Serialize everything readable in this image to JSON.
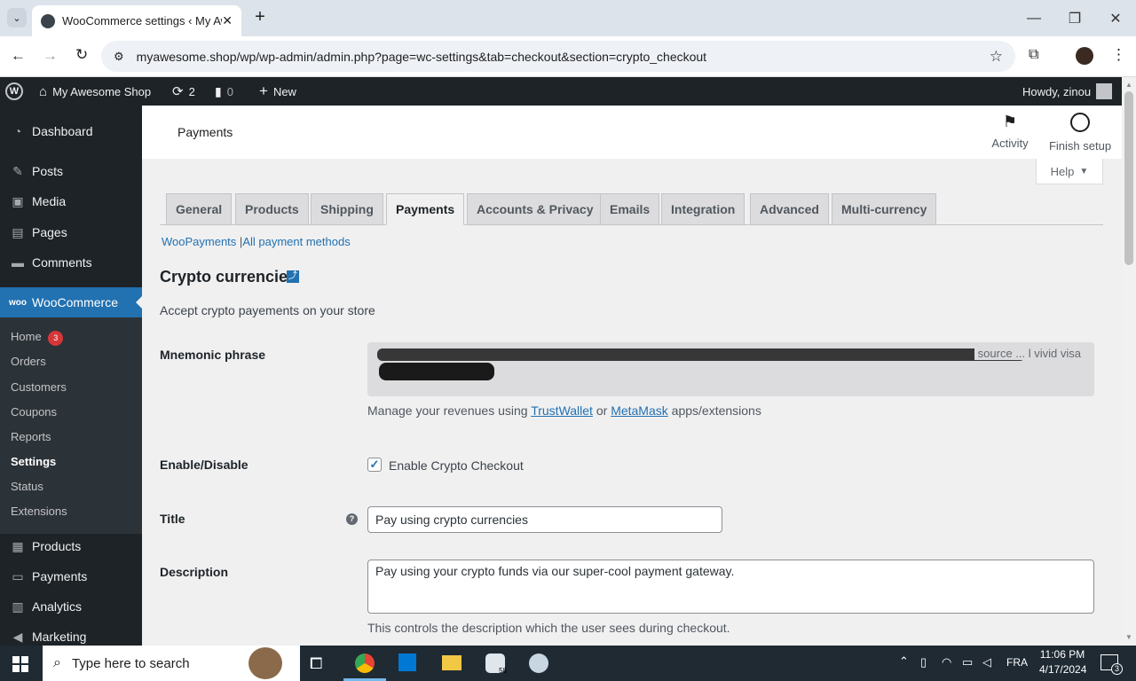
{
  "browser": {
    "tab_title": "WooCommerce settings ‹ My Awesome Shop",
    "url": "myawesome.shop/wp/wp-admin/admin.php?page=wc-settings&tab=checkout&section=crypto_checkout"
  },
  "adminbar": {
    "site_name": "My Awesome Shop",
    "updates_count": "2",
    "comments_count": "0",
    "new_label": "New",
    "howdy": "Howdy, zinou"
  },
  "sidebar": {
    "items_top": [
      {
        "label": "Dashboard",
        "icon": "dashboard-icon"
      },
      {
        "label": "Posts",
        "icon": "pin-icon"
      },
      {
        "label": "Media",
        "icon": "media-icon"
      },
      {
        "label": "Pages",
        "icon": "pages-icon"
      },
      {
        "label": "Comments",
        "icon": "comment-icon"
      }
    ],
    "woocommerce": "WooCommerce",
    "submenu": [
      {
        "label": "Home",
        "badge": "3"
      },
      {
        "label": "Orders"
      },
      {
        "label": "Customers"
      },
      {
        "label": "Coupons"
      },
      {
        "label": "Reports"
      },
      {
        "label": "Settings"
      },
      {
        "label": "Status"
      },
      {
        "label": "Extensions"
      }
    ],
    "items_bottom": [
      {
        "label": "Products"
      },
      {
        "label": "Payments"
      },
      {
        "label": "Analytics"
      },
      {
        "label": "Marketing"
      }
    ]
  },
  "header": {
    "page_title": "Payments",
    "activity": "Activity",
    "finish_setup": "Finish setup",
    "help": "Help"
  },
  "tabs": [
    "General",
    "Products",
    "Shipping",
    "Payments",
    "Accounts & Privacy",
    "Emails",
    "Integration",
    "Advanced",
    "Multi-currency"
  ],
  "sublinks": {
    "woopayments": "WooPayments",
    "separator": "|",
    "all_methods": "All payment methods"
  },
  "section": {
    "title": "Crypto currencies",
    "description": "Accept crypto payements on your store"
  },
  "fields": {
    "mnemonic_label": "Mnemonic phrase",
    "mnemonic_visible_tail": "source ... l vivid visa",
    "manage_prefix": "Manage your revenues using",
    "trustwallet": "TrustWallet",
    "or": "or",
    "metamask": "MetaMask",
    "manage_suffix": "apps/extensions",
    "enable_label": "Enable/Disable",
    "enable_checkbox": "Enable Crypto Checkout",
    "enable_checked": true,
    "title_label": "Title",
    "title_value": "Pay using crypto currencies",
    "description_label": "Description",
    "description_value": "Pay using your crypto funds via our super-cool payment gateway.",
    "description_help": "This controls the description which the user sees during checkout."
  },
  "taskbar": {
    "search_placeholder": "Type here to search",
    "time": "11:06 PM",
    "date": "4/17/2024",
    "lang": "FRA",
    "notif_count": "3",
    "app_badge": "58"
  }
}
